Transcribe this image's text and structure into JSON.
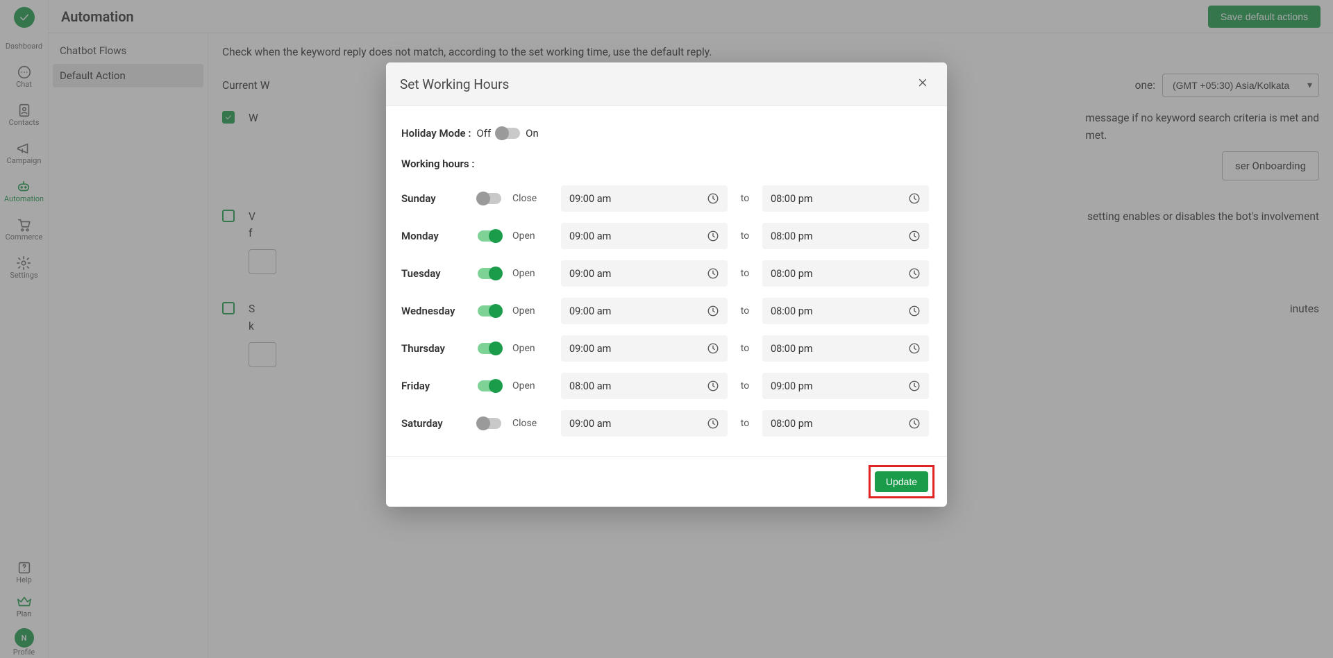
{
  "rail": {
    "dashboard": "Dashboard",
    "chat": "Chat",
    "contacts": "Contacts",
    "campaign": "Campaign",
    "automation": "Automation",
    "commerce": "Commerce",
    "settings": "Settings",
    "help": "Help",
    "plan": "Plan",
    "profile": "Profile",
    "avatar_initial": "N"
  },
  "header": {
    "title": "Automation",
    "save_btn": "Save default actions"
  },
  "subnav": {
    "chatbot_flows": "Chatbot Flows",
    "default_action": "Default Action"
  },
  "main": {
    "desc": "Check when the keyword reply does not match, according to the set working time, use the default reply.",
    "cw_label": "Current W",
    "tz_label": "one:",
    "tz_value": "(GMT +05:30) Asia/Kolkata",
    "sec1_partial_pre": "W",
    "sec1_text_tail": "message if no keyword search criteria is met and",
    "sec1_text_tail2": "met.",
    "sec1_select": "ser Onboarding",
    "sec2_char": "V",
    "sec2_text_tail": "setting enables or disables the bot's involvement",
    "sec2_line2": "f",
    "sec3_char": "S",
    "sec3_line2": "k",
    "sec3_tail": "inutes"
  },
  "modal": {
    "title": "Set Working Hours",
    "holiday_label": "Holiday Mode :",
    "off": "Off",
    "on": "On",
    "holiday_on": false,
    "wh_label": "Working hours :",
    "to": "to",
    "update": "Update",
    "days": [
      {
        "name": "Sunday",
        "open": false,
        "state": "Close",
        "from": "09:00 am",
        "to": "08:00 pm"
      },
      {
        "name": "Monday",
        "open": true,
        "state": "Open",
        "from": "09:00 am",
        "to": "08:00 pm"
      },
      {
        "name": "Tuesday",
        "open": true,
        "state": "Open",
        "from": "09:00 am",
        "to": "08:00 pm"
      },
      {
        "name": "Wednesday",
        "open": true,
        "state": "Open",
        "from": "09:00 am",
        "to": "08:00 pm"
      },
      {
        "name": "Thursday",
        "open": true,
        "state": "Open",
        "from": "09:00 am",
        "to": "08:00 pm"
      },
      {
        "name": "Friday",
        "open": true,
        "state": "Open",
        "from": "08:00 am",
        "to": "09:00 pm"
      },
      {
        "name": "Saturday",
        "open": false,
        "state": "Close",
        "from": "09:00 am",
        "to": "08:00 pm"
      }
    ]
  }
}
